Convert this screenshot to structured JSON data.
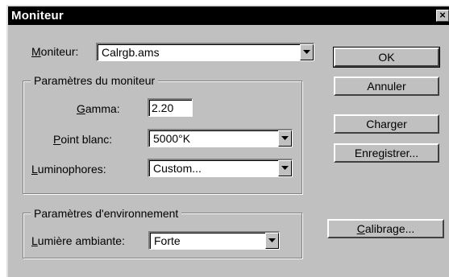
{
  "window": {
    "title": "Moniteur",
    "close_label": "×"
  },
  "moniteur": {
    "label_key": "M",
    "label_rest": "oniteur:",
    "value": "Calrgb.ams"
  },
  "params_monitor": {
    "title": "Paramètres du moniteur",
    "gamma": {
      "label_key": "G",
      "label_rest": "amma:",
      "value": "2.20"
    },
    "point_blanc": {
      "label_key": "P",
      "label_rest": "oint blanc:",
      "value": "5000°K"
    },
    "luminophores": {
      "label_key": "L",
      "label_rest": "uminophores:",
      "value": "Custom..."
    }
  },
  "params_env": {
    "title": "Paramètres d'environnement",
    "lumiere": {
      "label_key": "L",
      "label_rest": "umière ambiante:",
      "value": "Forte"
    }
  },
  "buttons": {
    "ok": "OK",
    "annuler": "Annuler",
    "charger": "Charger",
    "enregistrer": "Enregistrer...",
    "calibrage_key": "C",
    "calibrage_rest": "alibrage..."
  }
}
